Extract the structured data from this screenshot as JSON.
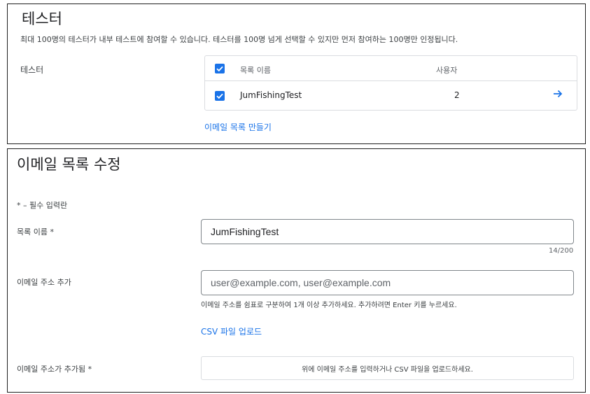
{
  "testers_section": {
    "title": "테스터",
    "description": "최대 100명의 테스터가 내부 테스트에 참여할 수 있습니다. 테스터를 100명 넘게 선택할 수 있지만 먼저 참여하는 100명만 인정됩니다.",
    "label": "테스터",
    "table": {
      "columns": [
        "목록 이름",
        "사용자"
      ],
      "rows": [
        {
          "name": "JumFishingTest",
          "users": "2",
          "checked": true
        }
      ]
    },
    "create_list_link": "이메일 목록 만들기"
  },
  "edit_section": {
    "title": "이메일 목록 수정",
    "required_note": "* – 필수 입력란",
    "list_name": {
      "label": "목록 이름 *",
      "value": "JumFishingTest",
      "counter": "14/200"
    },
    "add_email": {
      "label": "이메일 주소 추가",
      "placeholder": "user@example.com, user@example.com",
      "helper": "이메일 주소를 쉼표로 구분하여 1개 이상 추가하세요. 추가하려면 Enter 키를 누르세요."
    },
    "csv_upload_link": "CSV 파일 업로드",
    "added_emails": {
      "label": "이메일 주소가 추가됨 *",
      "empty_text": "위에 이메일 주소를 입력하거나 CSV 파일을 업로드하세요."
    }
  },
  "colors": {
    "accent": "#1a73e8",
    "border": "#dadce0",
    "text": "#202124"
  },
  "icons": {
    "checkbox": "checkbox-checked-icon",
    "arrow": "arrow-right-icon"
  }
}
